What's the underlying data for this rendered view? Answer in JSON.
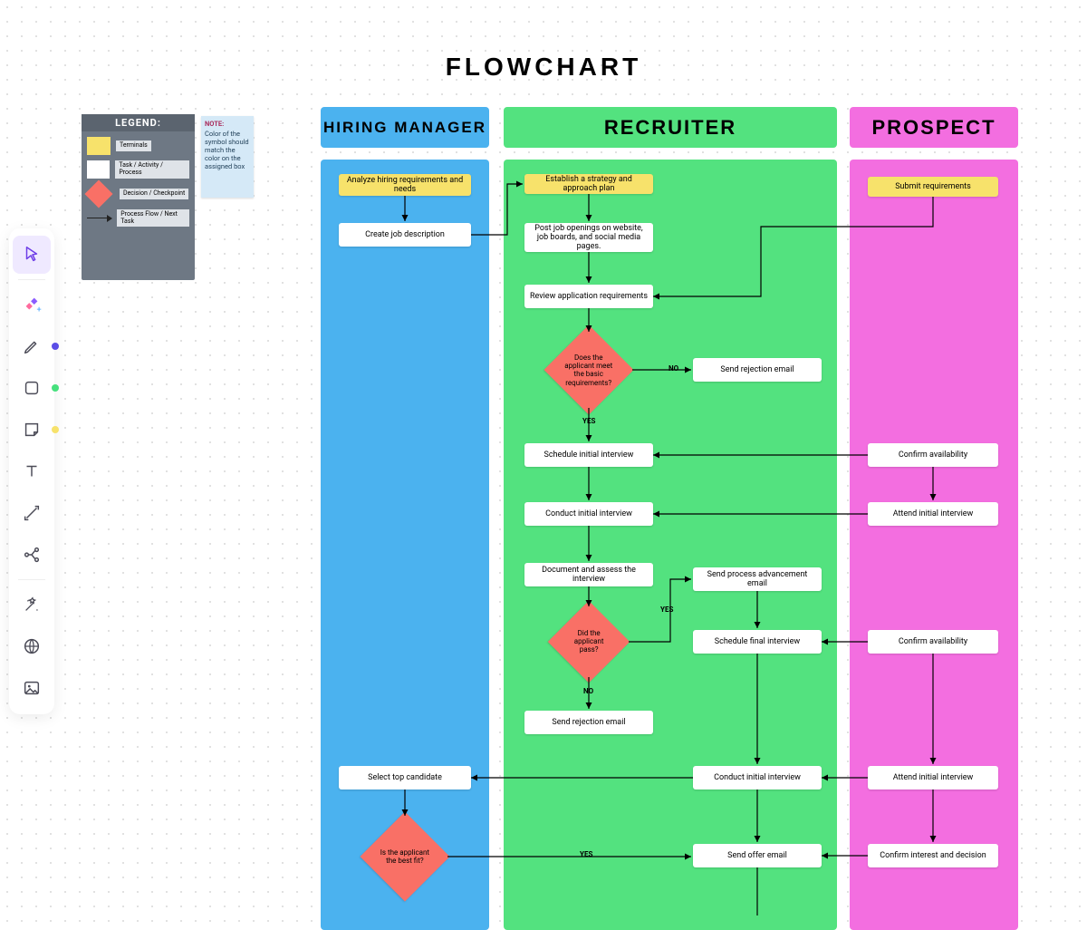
{
  "title": "FLOWCHART",
  "lanes": {
    "hiring_manager": "HIRING MANAGER",
    "recruiter": "RECRUITER",
    "prospect": "PROSPECT"
  },
  "legend": {
    "title": "LEGEND:",
    "items": {
      "terminals": "Terminals",
      "task": "Task / Activity / Process",
      "decision": "Decision / Checkpoint",
      "flow": "Process Flow / Next Task"
    }
  },
  "note": {
    "heading": "NOTE:",
    "body": "Color of the symbol should match the color on the assigned box"
  },
  "nodes": {
    "hm_analyze": "Analyze hiring requirements and needs",
    "hm_createjd": "Create job description",
    "rc_strategy": "Establish a strategy and approach plan",
    "rc_post": "Post job openings on website, job boards, and social media pages.",
    "rc_review": "Review application requirements",
    "rc_dec_basic": "Does the applicant meet the basic requirements?",
    "rc_rej1": "Send rejection email",
    "rc_sched1": "Schedule initial interview",
    "rc_conduct1": "Conduct initial interview",
    "rc_doc": "Document and assess the interview",
    "rc_dec_pass": "Did the applicant pass?",
    "rc_advance": "Send process advancement email",
    "rc_sched2": "Schedule final interview",
    "rc_conduct2": "Conduct initial interview",
    "rc_rej2": "Send rejection email",
    "rc_offer": "Send offer email",
    "pr_submit": "Submit requirements",
    "pr_conf1": "Confirm availability",
    "pr_attend1": "Attend initial interview",
    "pr_conf2": "Confirm availability",
    "pr_attend2": "Attend initial interview",
    "pr_conf3": "Confirm interest and decision",
    "hm_select": "Select top candidate",
    "hm_dec_fit": "Is the applicant the best fit?"
  },
  "edge_labels": {
    "no1": "NO",
    "yes1": "YES",
    "yes2": "YES",
    "no2": "NO",
    "yes3": "YES"
  }
}
